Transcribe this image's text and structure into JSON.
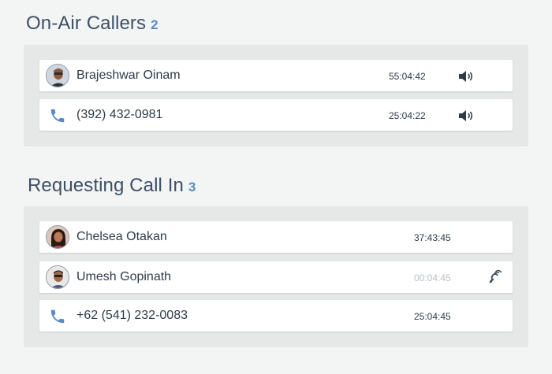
{
  "sections": [
    {
      "title": "On-Air Callers",
      "count": "2",
      "rows": [
        {
          "name": "Brajeshwar Oinam",
          "time": "55:04:42",
          "icon": "speaker-icon",
          "avatar": "avatar-brajeshwar"
        },
        {
          "name": "(392) 432-0981",
          "time": "25:04:22",
          "icon": "speaker-icon",
          "avatar": "phone-icon"
        }
      ]
    },
    {
      "title": "Requesting Call In",
      "count": "3",
      "rows": [
        {
          "name": "Chelsea Otakan",
          "time": "37:43:45",
          "avatar": "avatar-chelsea"
        },
        {
          "name": "Umesh Gopinath",
          "time": "00:04:45",
          "icon": "ear-listen-icon",
          "avatar": "avatar-umesh"
        },
        {
          "name": "+62 (541) 232-0083",
          "time": "25:04:45",
          "avatar": "phone-icon"
        }
      ]
    }
  ],
  "colors": {
    "accent": "#5b8bc2",
    "phone_icon": "#5b8bc2",
    "text": "#2f3b4a",
    "panel_bg": "#e6e7e7",
    "page_bg": "#f3f4f4",
    "dim_time": "#b9c0c8"
  }
}
